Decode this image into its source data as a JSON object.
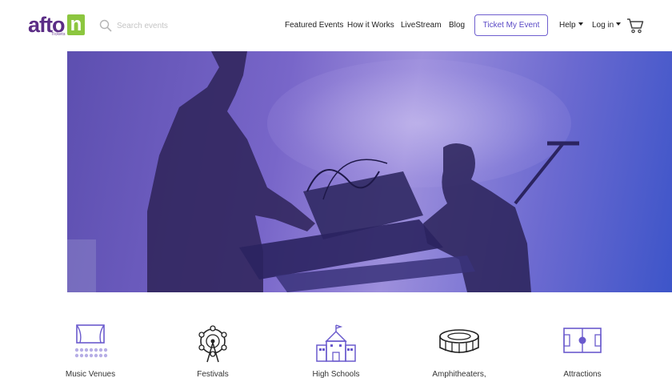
{
  "logo": {
    "text": "afto",
    "letter": "n",
    "subtext": "Tickets"
  },
  "search": {
    "placeholder": "Search events"
  },
  "nav": {
    "featured": "Featured Events",
    "how": "How it Works",
    "livestream": "LiveStream",
    "blog": "Blog",
    "ticket_button": "Ticket My Event",
    "help": "Help",
    "login": "Log in"
  },
  "categories": [
    {
      "label": "Music Venues",
      "icon": "stage-icon"
    },
    {
      "label": "Festivals",
      "icon": "ferris-wheel-icon"
    },
    {
      "label": "High Schools",
      "icon": "school-building-icon"
    },
    {
      "label": "Amphitheaters,",
      "icon": "stadium-icon"
    },
    {
      "label": "Attractions",
      "icon": "field-icon"
    }
  ],
  "colors": {
    "brand_purple": "#5b2d86",
    "brand_green": "#8cc63f",
    "accent": "#6f5fcf",
    "icon_purple": "#6a5acd"
  }
}
